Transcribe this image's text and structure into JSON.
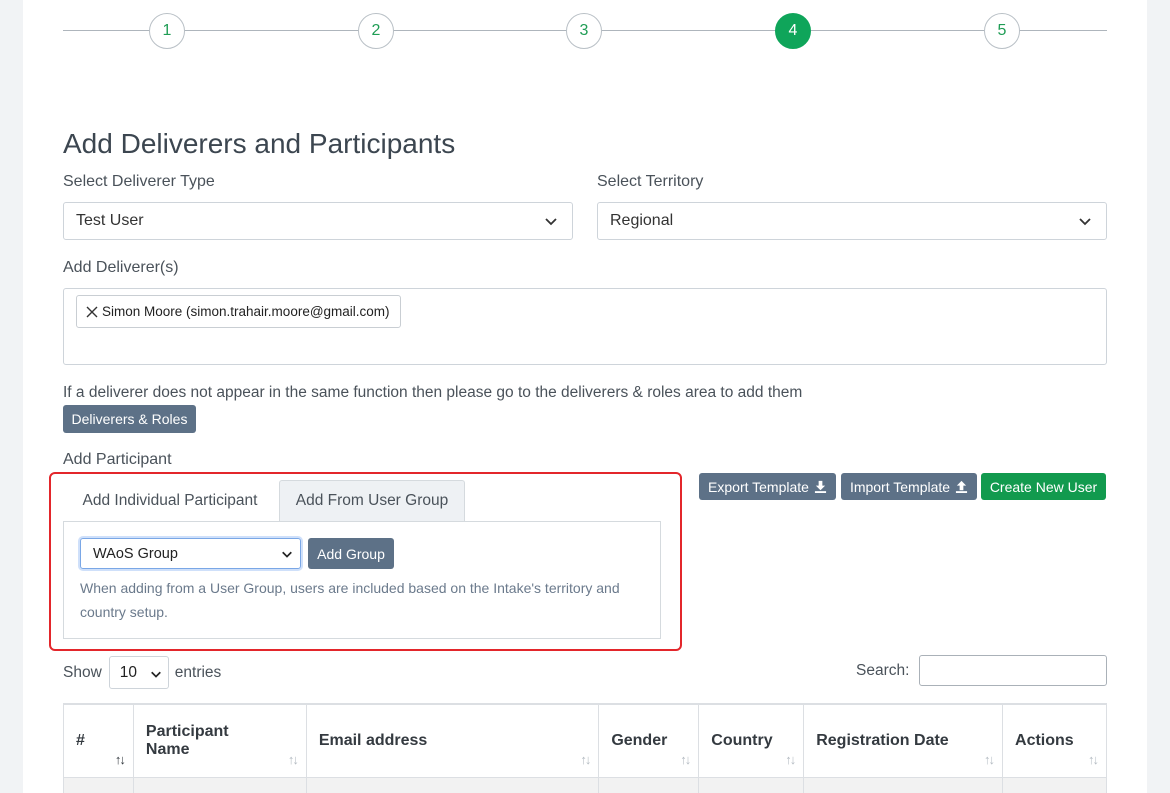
{
  "stepper": {
    "steps": [
      "1",
      "2",
      "3",
      "4",
      "5"
    ],
    "active_index": 3
  },
  "page_title": "Add Deliverers and Participants",
  "deliverer_type": {
    "label": "Select Deliverer Type",
    "value": "Test User"
  },
  "territory": {
    "label": "Select Territory",
    "value": "Regional"
  },
  "deliverers": {
    "label": "Add Deliverer(s)",
    "tags": [
      "Simon Moore (simon.trahair.moore@gmail.com)"
    ]
  },
  "deliverer_info": "If a deliverer does not appear in the same function then please go to the deliverers & roles area to add them",
  "deliverers_roles_button": "Deliverers & Roles",
  "participant": {
    "label": "Add Participant",
    "tabs": [
      "Add Individual Participant",
      "Add From User Group"
    ],
    "active_tab": 1,
    "group_select_value": "WAoS Group",
    "add_group_button": "Add Group",
    "help_text": "When adding from a User Group, users are included based on the Intake's territory and country setup."
  },
  "actions": {
    "export_template": "Export Template",
    "import_template": "Import Template",
    "create_new_user": "Create New User"
  },
  "table_controls": {
    "show_label": "Show",
    "page_length": "10",
    "entries_label": "entries",
    "search_label": "Search:"
  },
  "table": {
    "columns": [
      "#",
      "Participant Name",
      "Email address",
      "Gender",
      "Country",
      "Registration Date",
      "Actions"
    ]
  },
  "colors": {
    "accent_green": "#0fa55a",
    "button_slate": "#5d7187",
    "highlight_red": "#e3262b"
  }
}
